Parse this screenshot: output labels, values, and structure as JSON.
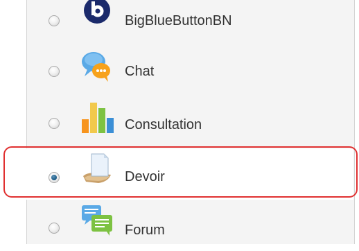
{
  "activities": [
    {
      "label": "BigBlueButtonBN",
      "icon": "bigbluebuttonbn-icon",
      "selected": false
    },
    {
      "label": "Chat",
      "icon": "chat-icon",
      "selected": false
    },
    {
      "label": "Consultation",
      "icon": "consultation-chart-icon",
      "selected": false
    },
    {
      "label": "Devoir",
      "icon": "assignment-document-icon",
      "selected": true
    },
    {
      "label": "Forum",
      "icon": "forum-icon",
      "selected": false
    }
  ],
  "colors": {
    "highlight": "#e03030",
    "panel_background": "#f4f4f4",
    "text": "#333333",
    "radio_selected": "#1f5f8a"
  }
}
